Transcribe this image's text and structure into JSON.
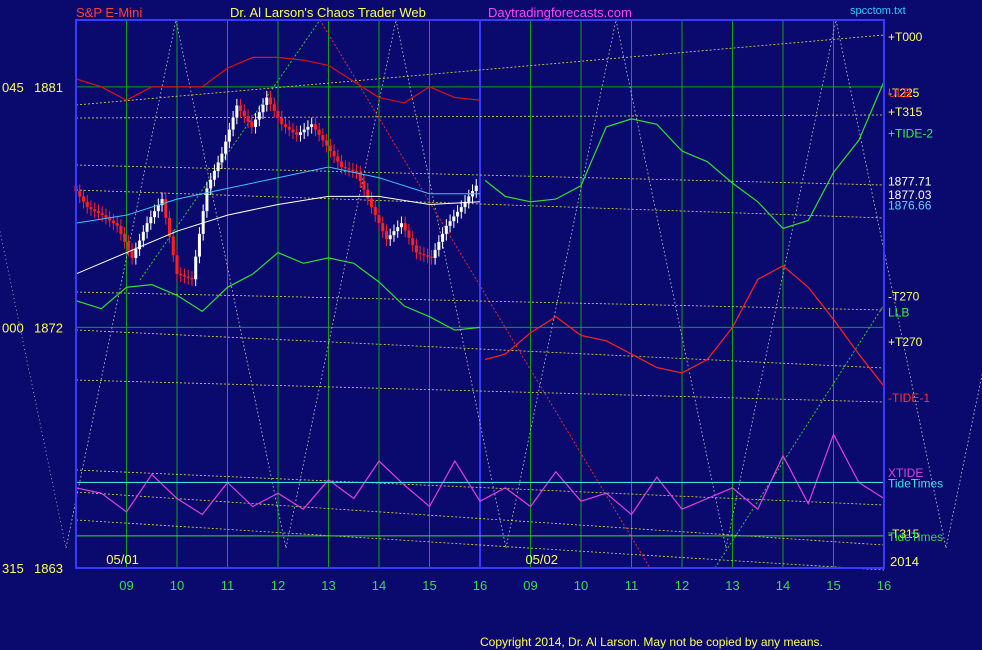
{
  "header": {
    "instrument": "S&P E-Mini",
    "author": "Dr. Al Larson's Chaos Trader Web",
    "site": "Daytradingforecasts.com",
    "file": "spcctom.txt"
  },
  "footer": {
    "copyright": "Copyright 2014, Dr. Al Larson. May not be copied by any means."
  },
  "colors": {
    "background": "#0a0a6e",
    "frame": "#3a3aff",
    "grid": "#10a010",
    "price_up": "#ffffff",
    "price_down": "#ff2020",
    "envelope": "#e01010",
    "tide1": "#ff2020",
    "tide2": "#33dd33",
    "xtide": "#e040e0",
    "tidetimes": "#40e0e0",
    "yellow_lines": "#e0e040",
    "white_lines": "#b0b0b0",
    "ma_cyan": "#40c0ff"
  },
  "chart_data": {
    "type": "line",
    "title": "",
    "x_ticks": [
      "09",
      "10",
      "11",
      "12",
      "13",
      "14",
      "15",
      "16",
      "09",
      "10",
      "11",
      "12",
      "13",
      "14",
      "15",
      "16"
    ],
    "date_labels": [
      {
        "label": "05/01",
        "hour": 8.6
      },
      {
        "label": "05/02",
        "hour": 16.9
      }
    ],
    "year_label": "2014",
    "y_left_labels": [
      {
        "prefix": "045",
        "value": 1881
      },
      {
        "prefix": "000",
        "value": 1872
      },
      {
        "prefix": "315",
        "value": 1863
      }
    ],
    "ylim": [
      1863,
      1883.5
    ],
    "right_labels": [
      {
        "text": "+T000",
        "color": "#ffff66",
        "price": 1882.9
      },
      {
        "text": "+TIDE-2",
        "color": "#44ee44",
        "price": 1879.3
      },
      {
        "text": "-T225",
        "color": "#ffff66",
        "price": 1880.8
      },
      {
        "text": "ULB",
        "color": "#ff3030",
        "price": 1880.8
      },
      {
        "text": "+T315",
        "color": "#ffff66",
        "price": 1880.1
      },
      {
        "text": "1877.71",
        "color": "#ffffff",
        "price": 1877.5
      },
      {
        "text": "1877.03",
        "color": "#ffffff",
        "price": 1877.0
      },
      {
        "text": "1876.66",
        "color": "#66ccff",
        "price": 1876.6
      },
      {
        "text": "-T270",
        "color": "#ffff66",
        "price": 1873.2
      },
      {
        "text": "LLB",
        "color": "#44ee44",
        "price": 1872.6
      },
      {
        "text": "+T270",
        "color": "#ffff66",
        "price": 1871.5
      },
      {
        "text": "-TIDE-1",
        "color": "#ff3030",
        "price": 1869.4
      },
      {
        "text": "XTIDE",
        "color": "#e040e0",
        "price": 1866.6
      },
      {
        "text": "TideTimes",
        "color": "#40e0e0",
        "price": 1866.2
      },
      {
        "text": "-T315",
        "color": "#ffff66",
        "price": 1864.3
      },
      {
        "text": "TideTimes",
        "color": "#33dd33",
        "price": 1864.2
      }
    ],
    "series": [
      {
        "name": "TIDE-2",
        "x": [
          16.1,
          16.5,
          17.0,
          17.5,
          18.0,
          18.5,
          19.0,
          19.5,
          20.0,
          20.5,
          21.0,
          21.5,
          22.0,
          22.5,
          23.0,
          23.5,
          24.0
        ],
        "y": [
          1877.5,
          1876.9,
          1876.7,
          1876.8,
          1877.3,
          1879.5,
          1879.8,
          1879.6,
          1878.6,
          1878.2,
          1877.4,
          1876.7,
          1875.7,
          1876.0,
          1877.8,
          1879.0,
          1881.2
        ]
      },
      {
        "name": "TIDE-1",
        "x": [
          16.1,
          16.5,
          17.0,
          17.5,
          18.0,
          18.5,
          19.0,
          19.5,
          20.0,
          20.5,
          21.0,
          21.5,
          22.0,
          22.5,
          23.0,
          23.5,
          24.0
        ],
        "y": [
          1870.8,
          1871.0,
          1871.8,
          1872.4,
          1871.7,
          1871.5,
          1871.0,
          1870.5,
          1870.3,
          1870.8,
          1872.0,
          1873.8,
          1874.3,
          1873.5,
          1872.3,
          1871.0,
          1869.8
        ]
      },
      {
        "name": "XTIDE",
        "x": [
          8.0,
          8.5,
          9.0,
          9.5,
          10.0,
          10.5,
          11.0,
          11.5,
          12.0,
          12.5,
          13.0,
          13.5,
          14.0,
          14.5,
          15.0,
          15.5,
          16.0,
          16.5,
          17.0,
          17.5,
          18.0,
          18.5,
          19.0,
          19.5,
          20.0,
          20.5,
          21.0,
          21.5,
          22.0,
          22.5,
          23.0,
          23.5,
          24.0
        ],
        "y": [
          1866.0,
          1865.8,
          1865.1,
          1866.5,
          1865.6,
          1865.0,
          1866.2,
          1865.3,
          1865.8,
          1865.2,
          1866.3,
          1865.6,
          1867.0,
          1866.1,
          1865.3,
          1867.0,
          1865.5,
          1866.0,
          1865.3,
          1866.6,
          1865.5,
          1865.8,
          1865.0,
          1866.4,
          1865.2,
          1865.6,
          1866.0,
          1865.2,
          1867.2,
          1865.4,
          1868.0,
          1866.2,
          1865.6
        ]
      },
      {
        "name": "ULB",
        "x": [
          8.0,
          8.5,
          9.0,
          9.5,
          10.0,
          10.5,
          11.0,
          11.5,
          12.0,
          12.5,
          13.0,
          13.5,
          14.0,
          14.5,
          15.0,
          15.5,
          16.0
        ],
        "y": [
          1881.3,
          1881.0,
          1880.5,
          1881.0,
          1881.0,
          1881.0,
          1881.7,
          1882.1,
          1882.1,
          1882.0,
          1881.8,
          1881.2,
          1880.6,
          1880.4,
          1881.0,
          1880.6,
          1880.5
        ]
      },
      {
        "name": "LLB",
        "x": [
          8.0,
          8.5,
          9.0,
          9.5,
          10.0,
          10.5,
          11.0,
          11.5,
          12.0,
          12.5,
          13.0,
          13.5,
          14.0,
          14.5,
          15.0,
          15.5,
          16.0
        ],
        "y": [
          1873.0,
          1872.7,
          1873.5,
          1873.6,
          1873.2,
          1872.6,
          1873.5,
          1874.0,
          1874.8,
          1874.4,
          1874.6,
          1874.4,
          1873.7,
          1872.8,
          1872.4,
          1871.9,
          1872.0
        ]
      }
    ]
  }
}
